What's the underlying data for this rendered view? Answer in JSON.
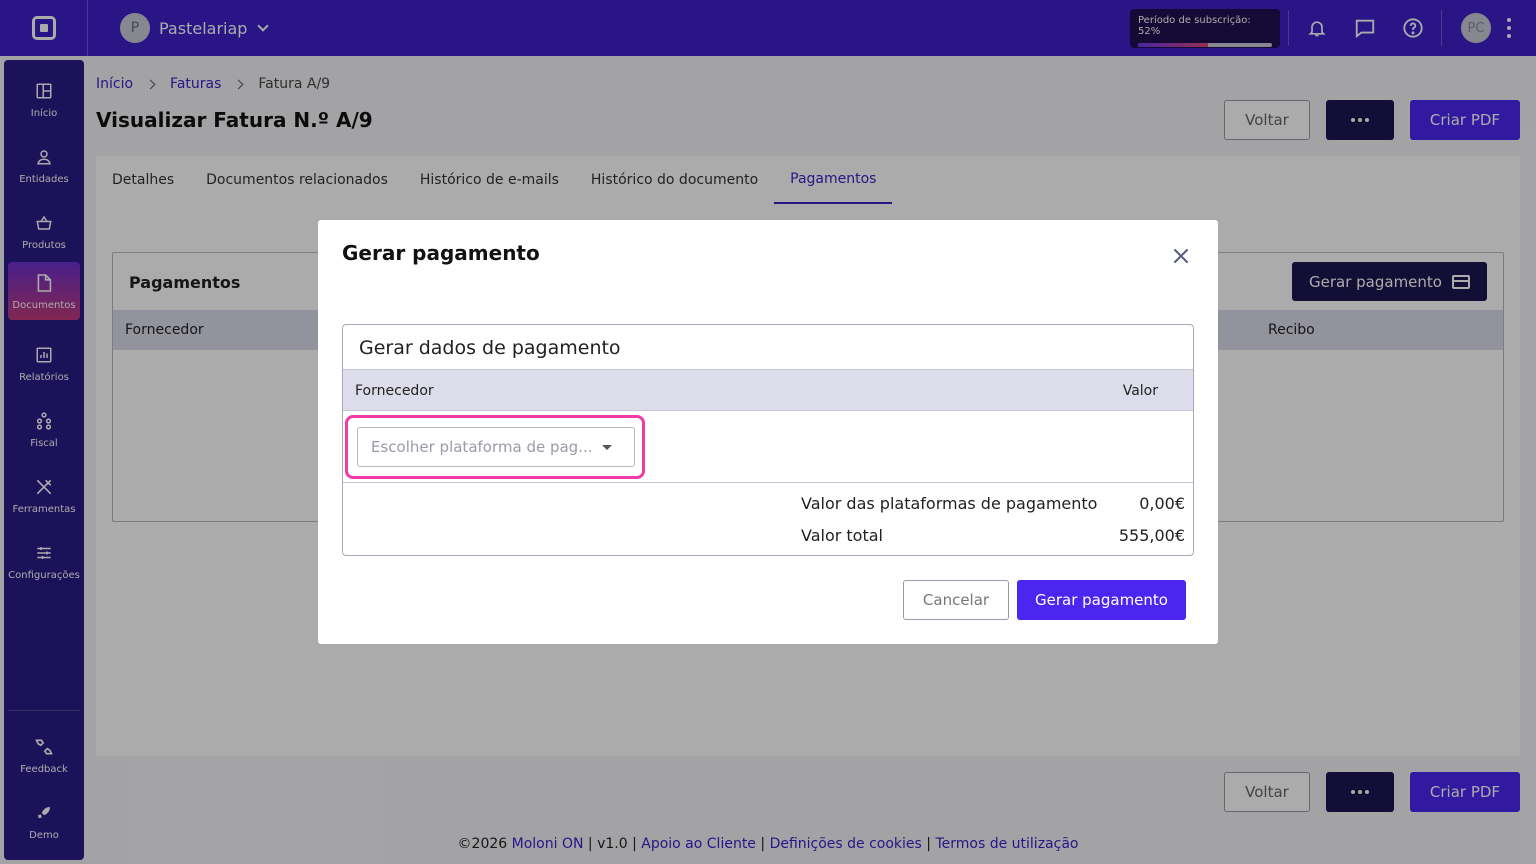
{
  "company": {
    "initial": "P",
    "name": "Pastelariap"
  },
  "subscription": {
    "label": "Período de subscrição: 52%",
    "progress_percent": 52
  },
  "user": {
    "initials": "PC"
  },
  "sidebar": {
    "items": [
      {
        "label": "Início",
        "icon": "dashboard-icon"
      },
      {
        "label": "Entidades",
        "icon": "user-icon"
      },
      {
        "label": "Produtos",
        "icon": "basket-icon"
      },
      {
        "label": "Documentos",
        "icon": "document-icon",
        "active": true
      },
      {
        "label": "Relatórios",
        "icon": "chart-icon"
      },
      {
        "label": "Fiscal",
        "icon": "hierarchy-icon"
      },
      {
        "label": "Ferramentas",
        "icon": "tools-icon"
      },
      {
        "label": "Configurações",
        "icon": "sliders-icon"
      }
    ],
    "bottom": [
      {
        "label": "Feedback",
        "icon": "feedback-icon"
      },
      {
        "label": "Demo",
        "icon": "rocket-icon"
      }
    ]
  },
  "breadcrumb": [
    "Início",
    "Faturas",
    "Fatura A/9"
  ],
  "page": {
    "title": "Visualizar Fatura N.º A/9"
  },
  "actions": {
    "back": "Voltar",
    "pdf": "Criar PDF"
  },
  "tabs": [
    "Detalhes",
    "Documentos relacionados",
    "Histórico de e-mails",
    "Histórico do documento",
    "Pagamentos"
  ],
  "payments": {
    "title": "Pagamentos",
    "generate_button": "Gerar pagamento",
    "columns": [
      "Fornecedor",
      "Recibo"
    ]
  },
  "modal": {
    "title": "Gerar pagamento",
    "section_title": "Gerar dados de pagamento",
    "columns": {
      "provider": "Fornecedor",
      "value": "Valor"
    },
    "select_placeholder": "Escolher plataforma de pag...",
    "summary": [
      {
        "label": "Valor das plataformas de pagamento",
        "value": "0,00€"
      },
      {
        "label": "Valor total",
        "value": "555,00€"
      }
    ],
    "cancel": "Cancelar",
    "confirm": "Gerar pagamento"
  },
  "footer": {
    "copyright": "©2026",
    "brand": "Moloni ON",
    "version": "v1.0",
    "links": [
      "Apoio ao Cliente",
      "Definições de cookies",
      "Termos de utilização"
    ],
    "separator": "|"
  }
}
